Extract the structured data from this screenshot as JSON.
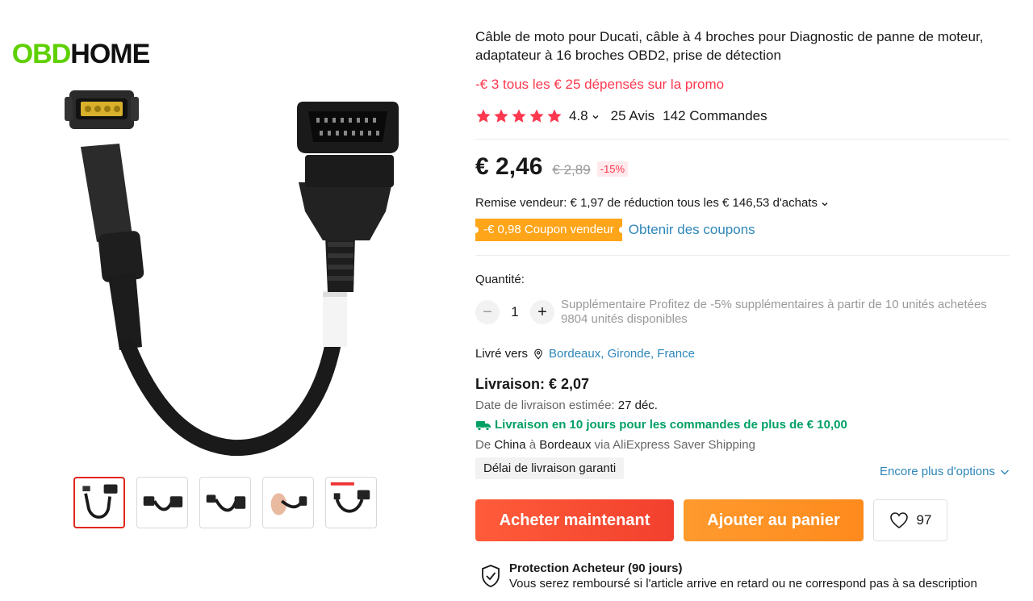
{
  "brand": {
    "logo_part1": "OBD",
    "logo_part2": "HOME"
  },
  "product": {
    "title": "Câble de moto pour Ducati, câble à 4 broches pour Diagnostic de panne de moteur, adaptateur à 16 broches OBD2, prise de détection",
    "promo": "-€ 3 tous les € 25 dépensés sur la promo",
    "rating": "4.8",
    "stars": 5,
    "reviews": "25 Avis",
    "orders": "142 Commandes"
  },
  "pricing": {
    "price": "€ 2,46",
    "old_price": "€ 2,89",
    "discount": "-15%",
    "remise": "Remise vendeur: € 1,97 de réduction tous les € 146,53 d'achats",
    "coupon": "-€ 0,98 Coupon vendeur",
    "get_coupons": "Obtenir des coupons"
  },
  "quantity": {
    "label": "Quantité:",
    "minus": "−",
    "value": "1",
    "plus": "+",
    "note_line1": "Supplémentaire Profitez de -5% supplémentaires à partir de 10 unités achetées",
    "note_line2": "9804 unités disponibles"
  },
  "shipping": {
    "to_label": "Livré vers",
    "location": "Bordeaux, Gironde, France",
    "cost": "Livraison: € 2,07",
    "est_label": "Date de livraison estimée:",
    "est_date": "27 déc.",
    "fast": "Livraison en 10 jours pour les commandes de plus de € 10,00",
    "route_de": "De",
    "route_from": "China",
    "route_a": "à",
    "route_to": "Bordeaux",
    "route_via": "via AliExpress Saver Shipping",
    "guarantee": "Délai de livraison garanti",
    "more_options": "Encore plus d'options"
  },
  "actions": {
    "buy_now": "Acheter maintenant",
    "add_to_cart": "Ajouter au panier",
    "wishlist_count": "97"
  },
  "protection": {
    "title": "Protection Acheteur (90 jours)",
    "description": "Vous serez remboursé si l'article arrive en retard ou ne correspond pas à sa description"
  },
  "colors": {
    "accent_red": "#fd384f",
    "link_blue": "#2e86b9",
    "coupon_orange": "#fea51a",
    "green": "#00a065"
  }
}
